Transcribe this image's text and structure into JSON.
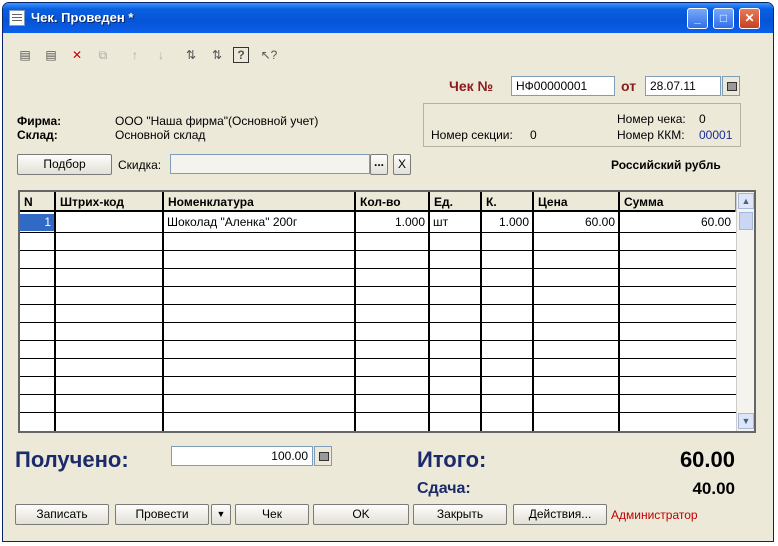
{
  "window": {
    "title": "Чек. Проведен *",
    "minimize": "_",
    "maximize": "□",
    "close": "✕"
  },
  "toolbar": {
    "icons": [
      "form-icon",
      "form-edit-icon",
      "form-delete-icon",
      "copy-icon",
      "arrow-up-icon",
      "arrow-down-icon",
      "sort-asc-icon",
      "sort-desc-icon",
      "help-icon",
      "context-help-icon"
    ]
  },
  "header": {
    "check_label": "Чек №",
    "check_number": "НФ00000001",
    "from_label": "от",
    "date": "28.07.11",
    "firm_label": "Фирма:",
    "firm_value": "ООО \"Наша фирма\"(Основной учет)",
    "warehouse_label": "Склад:",
    "warehouse_value": "Основной склад",
    "check_no_label": "Номер чека:",
    "check_no_value": "0",
    "section_label": "Номер секции:",
    "section_value": "0",
    "kkm_label": "Номер ККМ:",
    "kkm_value": "00001",
    "selection_button": "Подбор",
    "discount_label": "Скидка:",
    "discount_value": "",
    "dots": "...",
    "clear": "X",
    "currency": "Российский рубль"
  },
  "table": {
    "columns": [
      "N",
      "Штрих-код",
      "Номенклатура",
      "Кол-во",
      "Ед.",
      "К.",
      "Цена",
      "Сумма"
    ],
    "rows": [
      {
        "n": "1",
        "barcode": "",
        "item": "Шоколад \"Аленка\" 200г",
        "qty": "1.000",
        "unit": "шт",
        "k": "1.000",
        "price": "60.00",
        "sum": "60.00"
      }
    ]
  },
  "totals": {
    "received_label": "Получено:",
    "received_value": "100.00",
    "total_label": "Итого:",
    "total_value": "60.00",
    "change_label": "Сдача:",
    "change_value": "40.00"
  },
  "buttons": {
    "write": "Записать",
    "post": "Провести",
    "check": "Чек",
    "ok": "OK",
    "close": "Закрыть",
    "actions": "Действия..."
  },
  "status": {
    "user": "Администратор"
  },
  "colors": {
    "title_bar": "#0554d6",
    "check_label": "#8b1a1a",
    "total_navy": "#1b2a6b",
    "user": "#c00000"
  }
}
